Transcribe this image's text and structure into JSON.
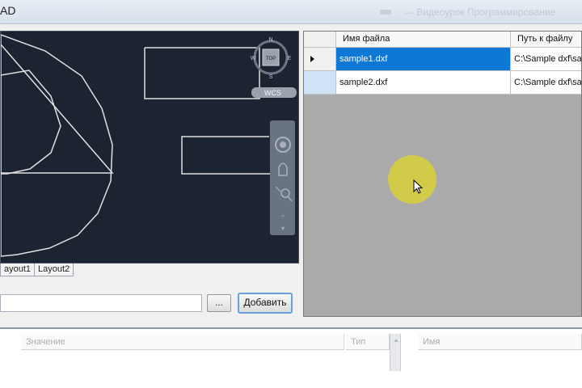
{
  "window": {
    "title": "AD",
    "faint_title_text": "— Видеоурок Программирование"
  },
  "cad": {
    "compass": {
      "north": "N",
      "south": "S",
      "west": "W",
      "east": "E",
      "top": "TOP"
    },
    "wcs_label": "WCS",
    "colors": {
      "background": "#1c2331",
      "lines": "#e0e0e0"
    }
  },
  "layout_tabs": [
    {
      "label": "ayout1"
    },
    {
      "label": "Layout2"
    }
  ],
  "path_input": {
    "value": ""
  },
  "browse_button": {
    "label": "..."
  },
  "add_button": {
    "label": "Добавить"
  },
  "grid": {
    "columns": [
      {
        "label": "Имя файла"
      },
      {
        "label": "Путь к файлу"
      }
    ],
    "rows": [
      {
        "name": "sample1.dxf",
        "path": "C:\\Sample dxf\\sam",
        "selected": true
      },
      {
        "name": "sample2.dxf",
        "path": "C:\\Sample dxf\\sam",
        "selected": false
      }
    ]
  },
  "properties": {
    "columns": [
      {
        "label": "Значение"
      },
      {
        "label": "Тип"
      },
      {
        "label": "Имя"
      }
    ]
  }
}
